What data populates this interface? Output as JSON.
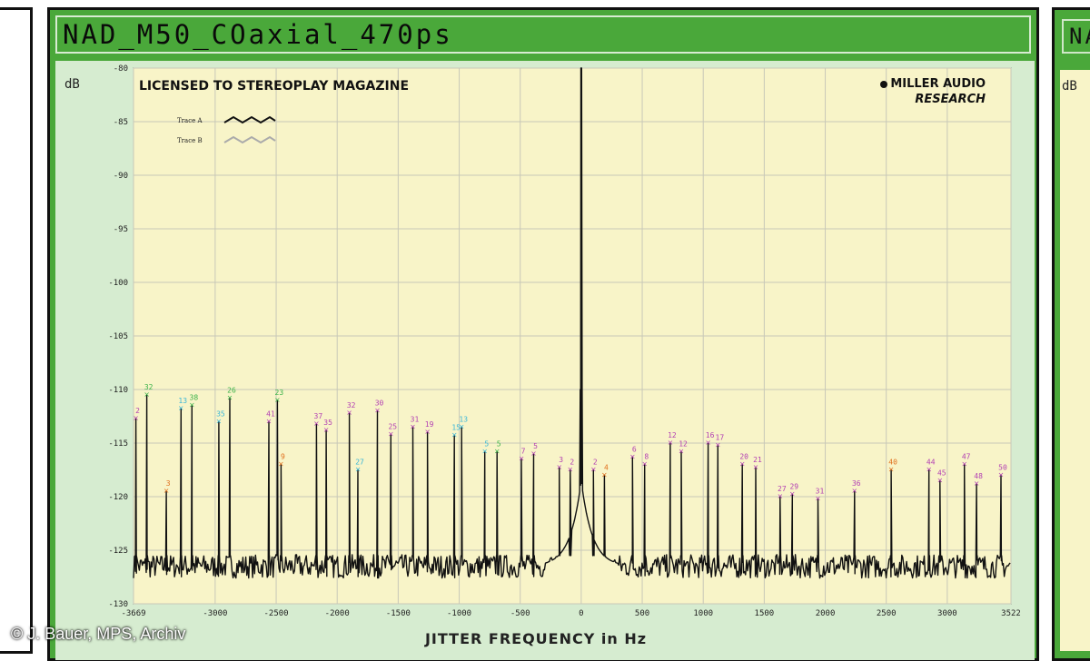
{
  "window": {
    "title": "NAD_M50_COaxial_470ps",
    "right_panel_title": "NA",
    "right_panel_unit": "dB",
    "credit": "© J. Bauer, MPS, Archiv"
  },
  "colors": {
    "frame_green": "#4aa83a",
    "plot_bg": "#f8f4c8",
    "trace_a": "#111111",
    "trace_b": "#aaaaaa"
  },
  "chart_data": {
    "type": "line",
    "title": "NAD_M50_COaxial_470ps",
    "xlabel": "JITTER FREQUENCY in Hz",
    "ylabel": "dB",
    "xlim": [
      -3669,
      3522
    ],
    "ylim": [
      -130,
      -80
    ],
    "grid": true,
    "x_ticks": [
      -3669,
      -3000,
      -2500,
      -2000,
      -1500,
      -1000,
      -500,
      0,
      500,
      1000,
      1500,
      2000,
      2500,
      3000,
      3522
    ],
    "x_tick_labels": [
      "-3669",
      "-3000",
      "-2500",
      "-2000",
      "-1500",
      "-1000",
      "-500",
      "0",
      "500",
      "1000",
      "1500",
      "2000",
      "2500",
      "3000",
      "3522"
    ],
    "y_ticks": [
      -80,
      -85,
      -90,
      -95,
      -100,
      -105,
      -110,
      -115,
      -120,
      -125,
      -130
    ],
    "y_tick_labels": [
      "-80",
      "-85",
      "-90",
      "-95",
      "-100",
      "-105",
      "-110",
      "-115",
      "-120",
      "-125",
      "-130"
    ],
    "annotations": {
      "license": "LICENSED TO STEREOPLAY MAGAZINE",
      "brand_line1": "MILLER AUDIO",
      "brand_line2": "RESEARCH"
    },
    "legend": {
      "placement": "top-left",
      "entries": [
        "Trace A",
        "Trace B"
      ]
    },
    "series": [
      {
        "name": "Trace A",
        "noise_floor_db": -126.5,
        "carrier": {
          "x": 0,
          "y": -80
        },
        "peaks": [
          {
            "x": -3650,
            "y": -112.7,
            "label": "2",
            "color": "#b23fb3"
          },
          {
            "x": -3560,
            "y": -110.5,
            "label": "32",
            "color": "#3bb24a"
          },
          {
            "x": -3400,
            "y": -119.5,
            "label": "3",
            "color": "#e0701e"
          },
          {
            "x": -3280,
            "y": -111.8,
            "label": "13",
            "color": "#3ab6d8"
          },
          {
            "x": -3190,
            "y": -111.5,
            "label": "38",
            "color": "#3bb24a"
          },
          {
            "x": -2970,
            "y": -113.0,
            "label": "35",
            "color": "#3ab6d8"
          },
          {
            "x": -2880,
            "y": -110.8,
            "label": "26",
            "color": "#3bb24a"
          },
          {
            "x": -2560,
            "y": -113.0,
            "label": "41",
            "color": "#b23fb3"
          },
          {
            "x": -2490,
            "y": -111.0,
            "label": "23",
            "color": "#3bb24a"
          },
          {
            "x": -2460,
            "y": -117.0,
            "label": "9",
            "color": "#e0701e"
          },
          {
            "x": -2170,
            "y": -113.2,
            "label": "37",
            "color": "#b23fb3"
          },
          {
            "x": -2090,
            "y": -113.8,
            "label": "35",
            "color": "#b23fb3"
          },
          {
            "x": -1900,
            "y": -112.2,
            "label": "32",
            "color": "#b23fb3"
          },
          {
            "x": -1830,
            "y": -117.5,
            "label": "27",
            "color": "#3ab6d8"
          },
          {
            "x": -1670,
            "y": -112.0,
            "label": "30",
            "color": "#b23fb3"
          },
          {
            "x": -1560,
            "y": -114.2,
            "label": "25",
            "color": "#b23fb3"
          },
          {
            "x": -1380,
            "y": -113.5,
            "label": "31",
            "color": "#b23fb3"
          },
          {
            "x": -1260,
            "y": -114.0,
            "label": "19",
            "color": "#b23fb3"
          },
          {
            "x": -1040,
            "y": -114.3,
            "label": "15",
            "color": "#3ab6d8"
          },
          {
            "x": -980,
            "y": -113.5,
            "label": "13",
            "color": "#3ab6d8"
          },
          {
            "x": -790,
            "y": -115.8,
            "label": "5",
            "color": "#3ab6d8"
          },
          {
            "x": -690,
            "y": -115.8,
            "label": "5",
            "color": "#3bb24a"
          },
          {
            "x": -490,
            "y": -116.5,
            "label": "7",
            "color": "#b23fb3"
          },
          {
            "x": -390,
            "y": -116.0,
            "label": "5",
            "color": "#b23fb3"
          },
          {
            "x": -180,
            "y": -117.3,
            "label": "3",
            "color": "#b23fb3"
          },
          {
            "x": -90,
            "y": -117.5,
            "label": "2",
            "color": "#b23fb3"
          },
          {
            "x": 100,
            "y": -117.5,
            "label": "2",
            "color": "#b23fb3"
          },
          {
            "x": 190,
            "y": -118.0,
            "label": "4",
            "color": "#e0701e"
          },
          {
            "x": 420,
            "y": -116.3,
            "label": "6",
            "color": "#b23fb3"
          },
          {
            "x": 520,
            "y": -117.0,
            "label": "8",
            "color": "#b23fb3"
          },
          {
            "x": 730,
            "y": -115.0,
            "label": "12",
            "color": "#b23fb3"
          },
          {
            "x": 820,
            "y": -115.8,
            "label": "12",
            "color": "#b23fb3"
          },
          {
            "x": 1040,
            "y": -115.0,
            "label": "16",
            "color": "#b23fb3"
          },
          {
            "x": 1120,
            "y": -115.2,
            "label": "17",
            "color": "#b23fb3"
          },
          {
            "x": 1320,
            "y": -117.0,
            "label": "20",
            "color": "#b23fb3"
          },
          {
            "x": 1430,
            "y": -117.3,
            "label": "21",
            "color": "#b23fb3"
          },
          {
            "x": 1630,
            "y": -120.0,
            "label": "27",
            "color": "#b23fb3"
          },
          {
            "x": 1730,
            "y": -119.8,
            "label": "29",
            "color": "#b23fb3"
          },
          {
            "x": 1940,
            "y": -120.2,
            "label": "31",
            "color": "#b23fb3"
          },
          {
            "x": 2240,
            "y": -119.5,
            "label": "36",
            "color": "#b23fb3"
          },
          {
            "x": 2540,
            "y": -117.5,
            "label": "40",
            "color": "#e0701e"
          },
          {
            "x": 2850,
            "y": -117.5,
            "label": "44",
            "color": "#b23fb3"
          },
          {
            "x": 2940,
            "y": -118.5,
            "label": "45",
            "color": "#b23fb3"
          },
          {
            "x": 3140,
            "y": -117.0,
            "label": "47",
            "color": "#b23fb3"
          },
          {
            "x": 3240,
            "y": -118.8,
            "label": "48",
            "color": "#b23fb3"
          },
          {
            "x": 3440,
            "y": -118.0,
            "label": "50",
            "color": "#b23fb3"
          }
        ]
      },
      {
        "name": "Trace B",
        "noise_floor_db": -126.5,
        "peaks": []
      }
    ]
  }
}
